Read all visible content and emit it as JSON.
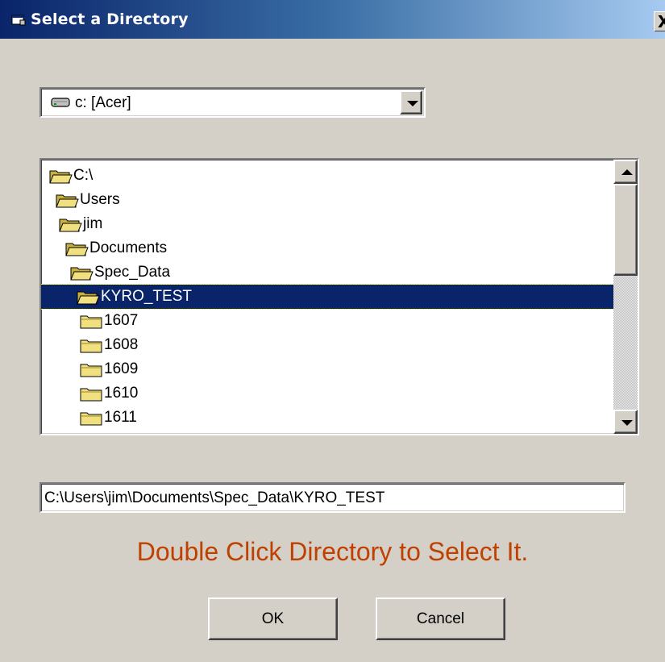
{
  "window": {
    "title": "Select a Directory",
    "close_label": "X"
  },
  "drive": {
    "selected": "c: [Acer]"
  },
  "tree": {
    "items": [
      {
        "label": "C:\\",
        "state": "open"
      },
      {
        "label": "Users",
        "state": "open"
      },
      {
        "label": "jim",
        "state": "open"
      },
      {
        "label": "Documents",
        "state": "open"
      },
      {
        "label": "Spec_Data",
        "state": "open"
      },
      {
        "label": "KYRO_TEST",
        "state": "open",
        "selected": true
      },
      {
        "label": "1607",
        "state": "closed"
      },
      {
        "label": "1608",
        "state": "closed"
      },
      {
        "label": "1609",
        "state": "closed"
      },
      {
        "label": "1610",
        "state": "closed"
      },
      {
        "label": "1611",
        "state": "closed"
      }
    ]
  },
  "path": {
    "value": "C:\\Users\\jim\\Documents\\Spec_Data\\KYRO_TEST"
  },
  "hint": "Double Click Directory to Select It.",
  "buttons": {
    "ok": "OK",
    "cancel": "Cancel"
  },
  "colors": {
    "title_start": "#0a246a",
    "title_end": "#a6caf0",
    "selection": "#0a246a",
    "hint": "#c04000",
    "face": "#d4d0c8",
    "folder": "#f0e080"
  }
}
